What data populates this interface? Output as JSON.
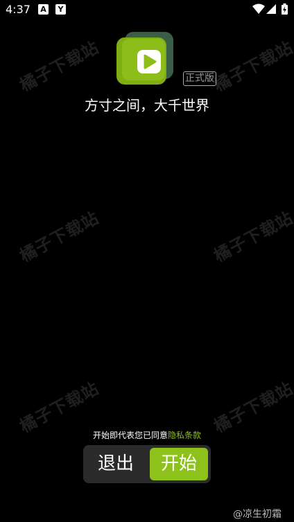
{
  "status_bar": {
    "time": "4:37",
    "notification_icons": [
      "a-icon",
      "y-icon"
    ],
    "system_icons": [
      "wifi-icon",
      "signal-icon",
      "battery-icon"
    ]
  },
  "watermark": {
    "text": "橘子下载站"
  },
  "app": {
    "logo_icon": "play-icon",
    "badge": "正式版",
    "slogan": "方寸之间，大千世界"
  },
  "consent": {
    "prefix": "开始即代表您已同意",
    "link": "隐私条款"
  },
  "actions": {
    "exit_label": "退出",
    "start_label": "开始"
  },
  "footer": {
    "credit": "@凉生初霜"
  },
  "colors": {
    "accent": "#8cc21b",
    "logo_back": "#3a5e46",
    "logo_front": "#7fae14",
    "background": "#000000",
    "button_bar": "#2b2b2b"
  }
}
